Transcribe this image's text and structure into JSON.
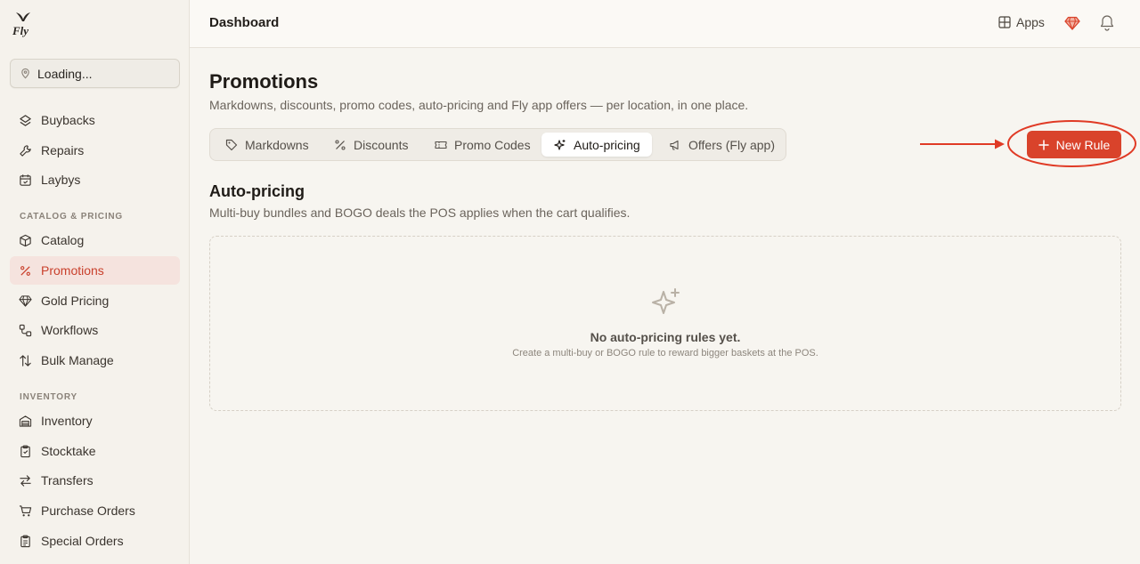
{
  "app": {
    "logo_text": "Fly"
  },
  "location": {
    "label": "Loading..."
  },
  "sidebar": {
    "top_items": [
      {
        "label": "Buybacks",
        "icon": "buyback-icon"
      },
      {
        "label": "Repairs",
        "icon": "wrench-icon"
      },
      {
        "label": "Laybys",
        "icon": "calendar-icon"
      }
    ],
    "sections": [
      {
        "label": "CATALOG & PRICING",
        "items": [
          {
            "label": "Catalog",
            "icon": "box-icon"
          },
          {
            "label": "Promotions",
            "icon": "percent-icon",
            "active": true
          },
          {
            "label": "Gold Pricing",
            "icon": "gem-icon"
          },
          {
            "label": "Workflows",
            "icon": "workflow-icon"
          },
          {
            "label": "Bulk Manage",
            "icon": "sort-arrows-icon"
          }
        ]
      },
      {
        "label": "INVENTORY",
        "items": [
          {
            "label": "Inventory",
            "icon": "inventory-icon"
          },
          {
            "label": "Stocktake",
            "icon": "clipboard-icon"
          },
          {
            "label": "Transfers",
            "icon": "transfer-icon"
          },
          {
            "label": "Purchase Orders",
            "icon": "cart-icon"
          },
          {
            "label": "Special Orders",
            "icon": "clipboard-list-icon"
          }
        ]
      }
    ]
  },
  "header": {
    "title": "Dashboard",
    "apps_label": "Apps"
  },
  "page": {
    "title": "Promotions",
    "subtitle": "Markdowns, discounts, promo codes, auto-pricing and Fly app offers — per location, in one place.",
    "tabs": [
      {
        "label": "Markdowns",
        "icon": "tag-icon"
      },
      {
        "label": "Discounts",
        "icon": "percent-icon"
      },
      {
        "label": "Promo Codes",
        "icon": "ticket-icon"
      },
      {
        "label": "Auto-pricing",
        "icon": "sparkle-icon",
        "active": true
      },
      {
        "label": "Offers (Fly app)",
        "icon": "megaphone-icon"
      }
    ],
    "new_rule_label": "New Rule",
    "section_title": "Auto-pricing",
    "section_subtitle": "Multi-buy bundles and BOGO deals the POS applies when the cart qualifies.",
    "empty_title": "No auto-pricing rules yet.",
    "empty_subtitle": "Create a multi-buy or BOGO rule to reward bigger baskets at the POS."
  },
  "colors": {
    "accent": "#d9432b",
    "annotation": "#e03a25",
    "active_nav_bg": "#f5e3de"
  }
}
